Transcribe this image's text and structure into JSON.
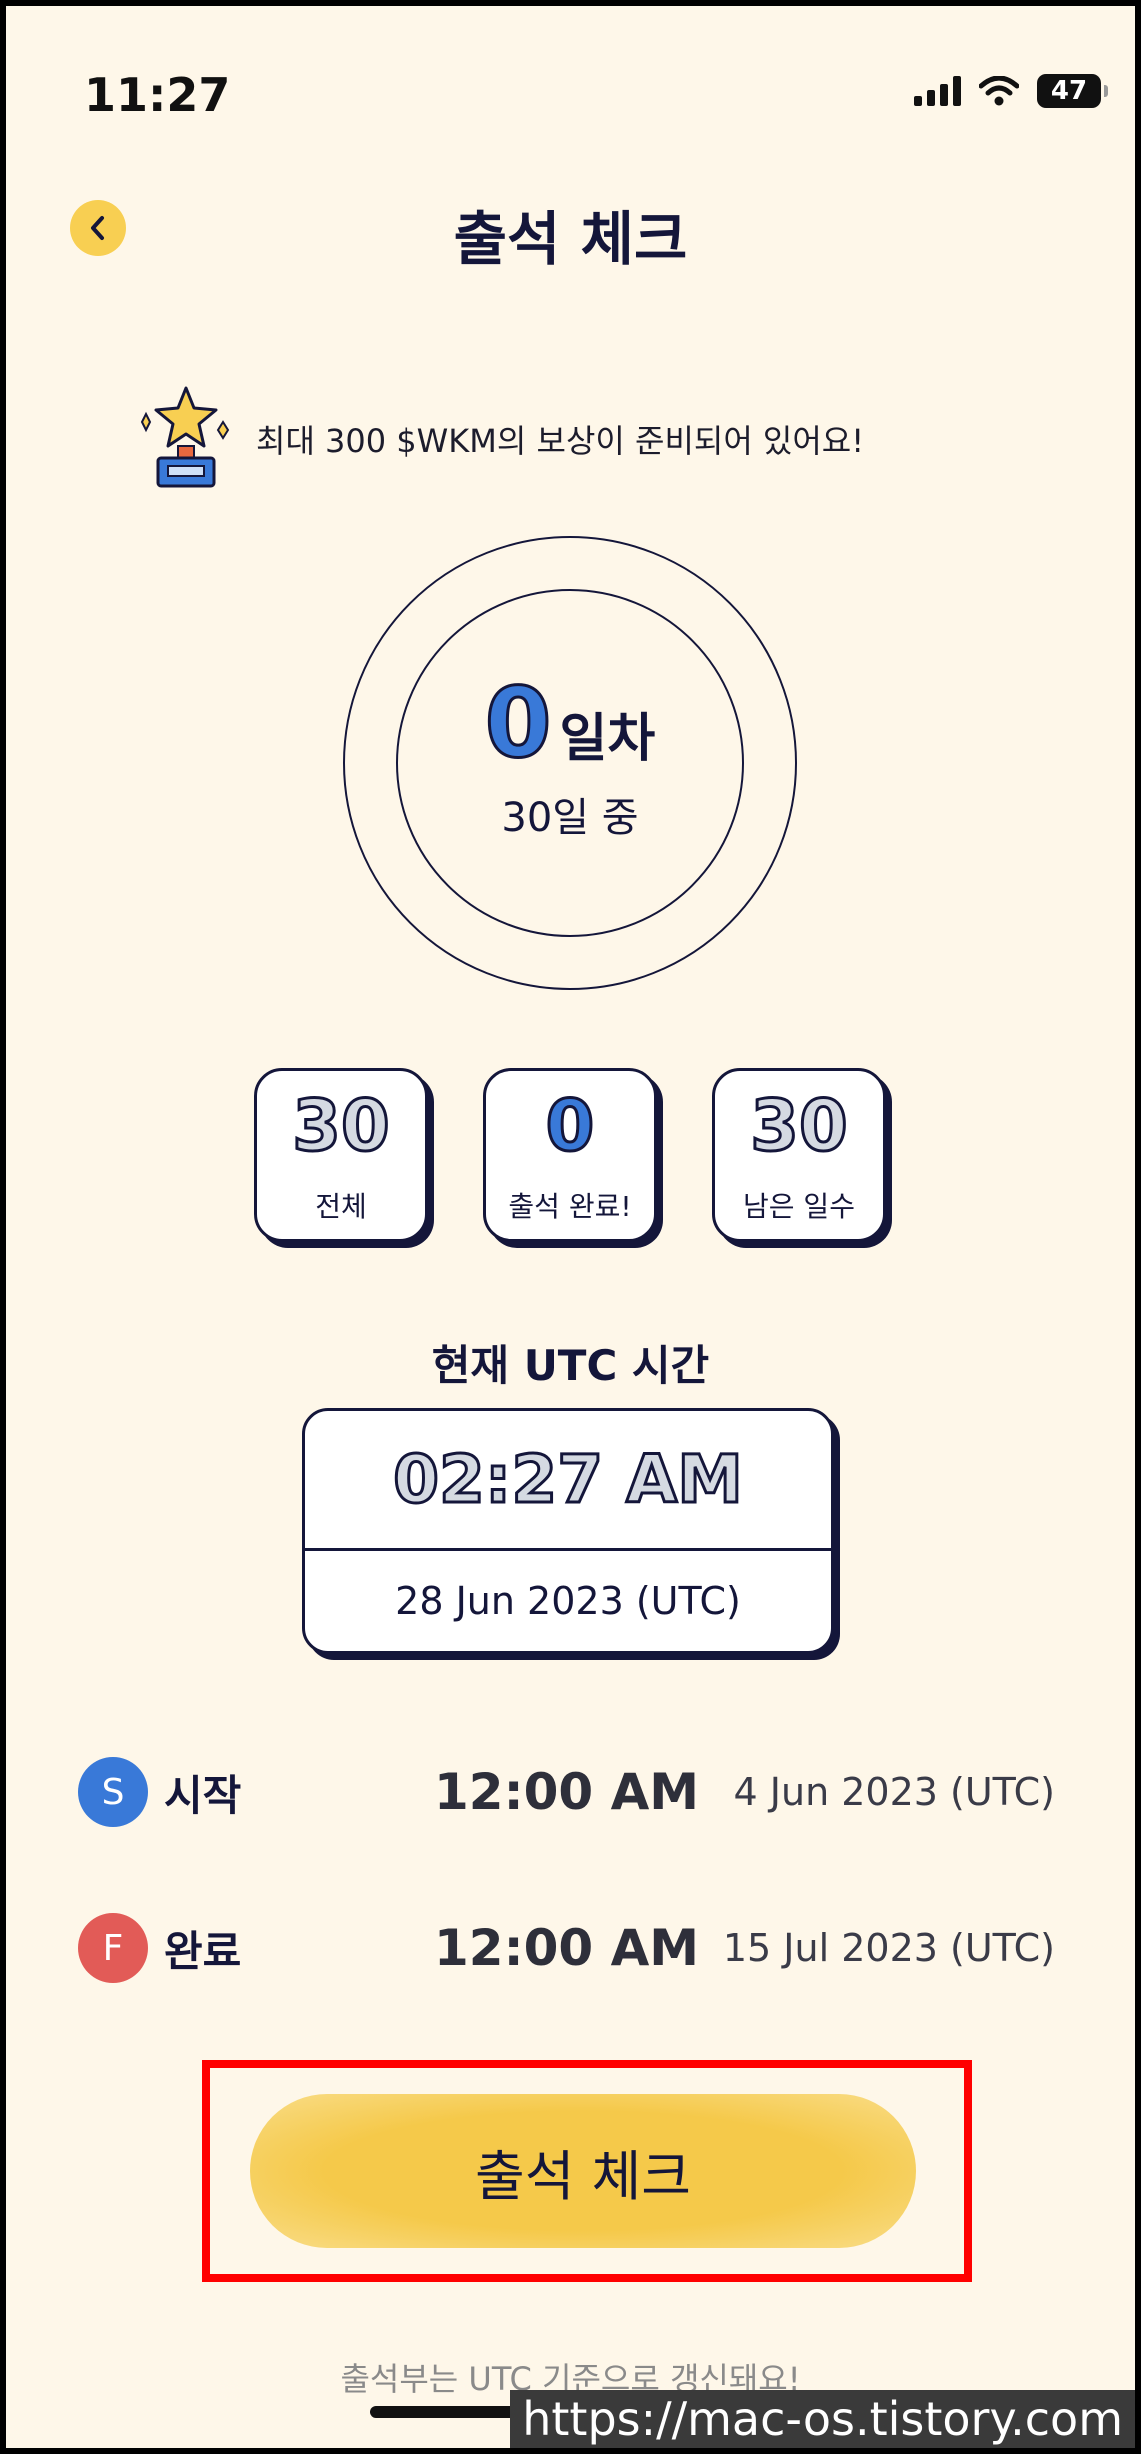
{
  "status_bar": {
    "time": "11:27",
    "battery": "47"
  },
  "header": {
    "title": "출석 체크",
    "back_icon": "chevron-left-icon"
  },
  "reward": {
    "text": "최대 300 $WKM의 보상이 준비되어 있어요!",
    "icon": "trophy-star-icon"
  },
  "progress": {
    "current_day": "0",
    "day_label": "일차",
    "total_label": "30일 중"
  },
  "stats": [
    {
      "value": "30",
      "label": "전체"
    },
    {
      "value": "0",
      "label": "출석 완료!"
    },
    {
      "value": "30",
      "label": "남은 일수"
    }
  ],
  "utc": {
    "title": "현재 UTC 시간",
    "time": "02:27 AM",
    "date": "28 Jun 2023 (UTC)"
  },
  "schedule": [
    {
      "badge": "S",
      "label": "시작",
      "time": "12:00 AM",
      "date": "4 Jun 2023 (UTC)"
    },
    {
      "badge": "F",
      "label": "완료",
      "time": "12:00 AM",
      "date": "15 Jul 2023 (UTC)"
    }
  ],
  "action": {
    "check_button": "출석 체크"
  },
  "footnote": "출석부는 UTC 기준으로 갱신돼요!",
  "watermark": "https://mac-os.tistory.com",
  "colors": {
    "background": "#fef7e9",
    "accent_yellow": "#f8cf52",
    "blue": "#3979d8",
    "red": "#e25b57",
    "navy": "#14163a",
    "highlight": "#ff0000"
  }
}
